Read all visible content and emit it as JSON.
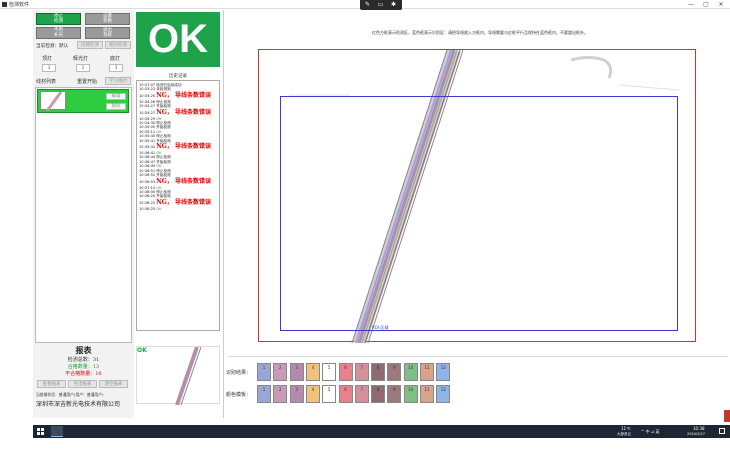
{
  "window": {
    "title": "检测软件",
    "minimize": "—",
    "maximize": "▢",
    "close": "✕"
  },
  "capture_bar": {
    "icons": [
      "pen-icon",
      "screen-icon",
      "settings-icon"
    ]
  },
  "left": {
    "btn_stop": "停止\n检测",
    "btn_setting": "设置\n参数",
    "btn_nolight": "不用\n补光",
    "btn_exit": "退出\n系统",
    "current_mode_label": "当前检测：默认",
    "btn_same": "同侧检测",
    "btn_cross": "相对检测",
    "lamp_labels": [
      "顶灯",
      "辉光灯",
      "底灯"
    ],
    "lamp_values": [
      "3",
      "2",
      "3"
    ],
    "material_list_label": "线材列表",
    "btn_start": "重置开始",
    "btn_learn": "学习线材",
    "material_item_btns": [
      "编辑",
      "删除"
    ],
    "report": {
      "title": "报表",
      "total_label": "检测总数：",
      "total_value": "31",
      "pass_label": "合格数量：",
      "pass_value": "13",
      "fail_label": "不合格数量：",
      "fail_value": "18"
    },
    "btn_view": "查看报表",
    "btn_export": "导出报表",
    "btn_clear": "清空报表",
    "operator": "当前操作员：普通用户(用户：普通用户)",
    "company": "深圳市深吉新光电技术有限公司"
  },
  "result": {
    "status": "OK",
    "small_status": "OK"
  },
  "history": {
    "title": "历史记录",
    "rows": [
      {
        "time": "10:37:07",
        "msg": "检测已启动成功",
        "type": "info"
      },
      {
        "time": "10:33:22",
        "msg": "未检测到",
        "type": "info"
      },
      {
        "time": "10:34:20",
        "msg": "NG， 导线条数错误",
        "type": "ng"
      },
      {
        "time": "10:34:26",
        "msg": "停止检测",
        "type": "info"
      },
      {
        "time": "10:34:27",
        "msg": "开始检测",
        "type": "info"
      },
      {
        "time": "10:34:27",
        "msg": "NG， 导线条数错误",
        "type": "ng"
      },
      {
        "time": "10:34:29",
        "msg": "OK",
        "type": "ok"
      },
      {
        "time": "10:34:30",
        "msg": "停止检测",
        "type": "info"
      },
      {
        "time": "10:35:00",
        "msg": "开始检测",
        "type": "info"
      },
      {
        "time": "10:35:11",
        "msg": "OK",
        "type": "ok"
      },
      {
        "time": "10:35:40",
        "msg": "停止检测",
        "type": "info"
      },
      {
        "time": "10:35:41",
        "msg": "开始检测",
        "type": "info"
      },
      {
        "time": "10:35:42",
        "msg": "NG， 导线条数错误",
        "type": "ng"
      },
      {
        "time": "10:36:41",
        "msg": "OK",
        "type": "ok"
      },
      {
        "time": "10:36:44",
        "msg": "停止检测",
        "type": "info"
      },
      {
        "time": "10:36:47",
        "msg": "开始检测",
        "type": "info"
      },
      {
        "time": "10:36:49",
        "msg": "OK",
        "type": "ok"
      },
      {
        "time": "10:36:51",
        "msg": "停止检测",
        "type": "info"
      },
      {
        "time": "10:36:52",
        "msg": "开始检测",
        "type": "info"
      },
      {
        "time": "10:36:53",
        "msg": "NG， 导线条数错误",
        "type": "ng"
      },
      {
        "time": "10:37:10",
        "msg": "OK",
        "type": "ok"
      },
      {
        "time": "10:38:00",
        "msg": "停止检测",
        "type": "info"
      },
      {
        "time": "10:38:20",
        "msg": "开始检测",
        "type": "info"
      },
      {
        "time": "10:38:22",
        "msg": "NG， 导线条数错误",
        "type": "ng"
      },
      {
        "time": "10:38:25",
        "msg": "OK",
        "type": "ok"
      }
    ]
  },
  "camera": {
    "instruction": "红色方框表示检测区，蓝色框表示识别区：请把导线放入方框内，导线需要与红框平行且保持在蓝色框内，不要超出框外。",
    "roi_label": "ROI 区域"
  },
  "colors": {
    "recognition_label": "识别结果：",
    "template_label": "颜色模板：",
    "swatch_numbers": [
      "1",
      "2",
      "3",
      "4",
      "5",
      "6",
      "7",
      "8",
      "9",
      "10",
      "11",
      "12"
    ],
    "recognition_swatches": [
      "#9aa7d6",
      "#c79ab8",
      "#b58ab0",
      "#f3c27a",
      "#ffffff",
      "#e8818b",
      "#d4909c",
      "#8f6a70",
      "#9a7a7a",
      "#7fbf86",
      "#d9a28b",
      "#8db3e8"
    ],
    "template_swatches": [
      "#9aa7d6",
      "#c79ab8",
      "#b58ab0",
      "#f3c27a",
      "#ffffff",
      "#e8818b",
      "#d4909c",
      "#8f6a70",
      "#9a7a7a",
      "#7fbf86",
      "#d9a28b",
      "#8db3e8"
    ]
  },
  "taskbar": {
    "weather_temp": "11℃",
    "weather_text": "大部多云",
    "tray_icons": "^ 中 ⊿ 英",
    "time": "10:38",
    "date": "2024/3/27"
  },
  "accent_colors": {
    "green": "#1fa34a",
    "ng_red": "#e00000",
    "frame_red": "#cc3333",
    "roi_blue": "#3b3bd0"
  }
}
